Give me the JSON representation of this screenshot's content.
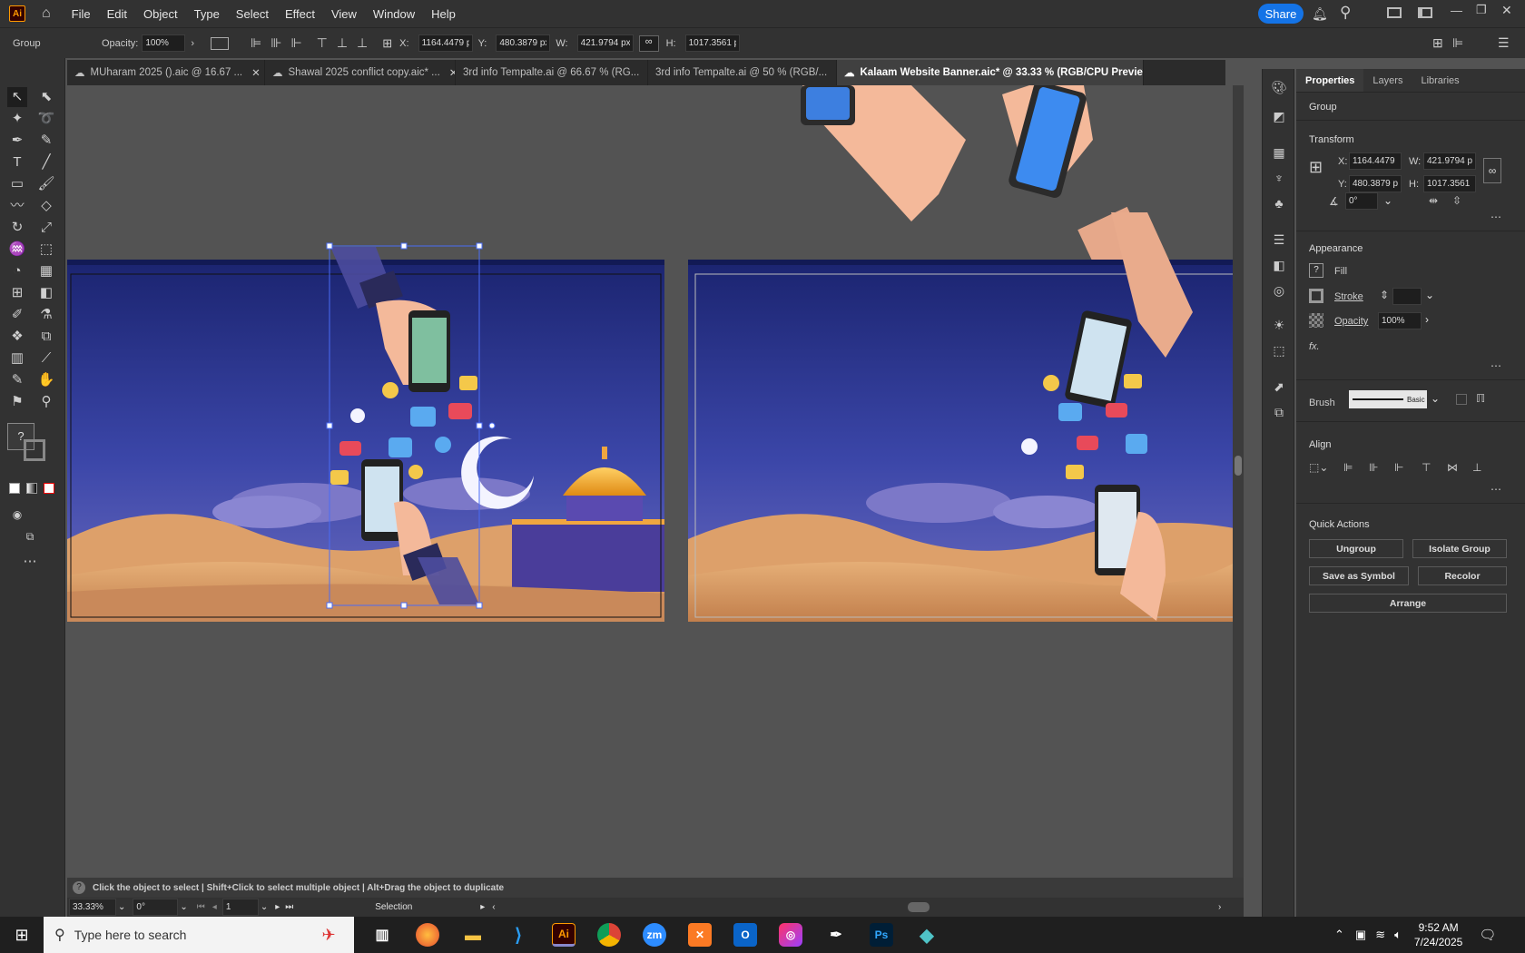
{
  "menubar": {
    "app_icon": "Ai",
    "items": [
      "File",
      "Edit",
      "Object",
      "Type",
      "Select",
      "Effect",
      "View",
      "Window",
      "Help"
    ],
    "share_label": "Share",
    "icons": [
      "home-icon",
      "bell-icon",
      "search-icon",
      "arrange-icon",
      "panel-icon",
      "minimize-icon",
      "restore-icon",
      "close-icon"
    ]
  },
  "control": {
    "selection_label": "Group",
    "opacity_label": "Opacity:",
    "opacity_value": "100%",
    "x_label": "X:",
    "x_value": "1164.4479 px",
    "y_label": "Y:",
    "y_value": "480.3879 px",
    "w_label": "W:",
    "w_value": "421.9794 px",
    "h_label": "H:",
    "h_value": "1017.3561 p"
  },
  "tabs": [
    {
      "label": "MUharam 2025 ().aic @ 16.67 ...",
      "active": false
    },
    {
      "label": "Shawal 2025 conflict copy.aic* ...",
      "active": false
    },
    {
      "label": "3rd info Tempalte.ai @ 66.67 % (RG...",
      "active": false
    },
    {
      "label": "3rd info Tempalte.ai @ 50 % (RGB/...",
      "active": false
    },
    {
      "label": "Kalaam Website Banner.aic* @ 33.33 % (RGB/CPU Preview)",
      "active": true
    }
  ],
  "status": {
    "hint": "Click the object to select  |  Shift+Click to select multiple object  |  Alt+Drag the object to duplicate",
    "zoom": "33.33%",
    "rotation": "0°",
    "artboard": "1",
    "tool": "Selection"
  },
  "properties": {
    "tabs": [
      "Properties",
      "Layers",
      "Libraries"
    ],
    "selection": "Group",
    "transform_title": "Transform",
    "x_label": "X:",
    "x": "1164.4479",
    "y_label": "Y:",
    "y": "480.3879 p",
    "w_label": "W:",
    "w": "421.9794 p",
    "h_label": "H:",
    "h": "1017.3561",
    "angle": "0°",
    "appearance_title": "Appearance",
    "fill_label": "Fill",
    "stroke_label": "Stroke",
    "opacity_label": "Opacity",
    "opacity_value": "100%",
    "fx_label": "fx.",
    "brush_label": "Brush",
    "brush_value": "Basic",
    "align_title": "Align",
    "quick_actions_title": "Quick Actions",
    "btn_ungroup": "Ungroup",
    "btn_isolate": "Isolate Group",
    "btn_symbol": "Save as Symbol",
    "btn_recolor": "Recolor",
    "btn_arrange": "Arrange"
  },
  "taskbar": {
    "search_placeholder": "Type here to search",
    "apps": [
      "task-view",
      "firefox",
      "file-explorer",
      "vscode",
      "illustrator",
      "chrome",
      "zoom",
      "xampp",
      "outlook",
      "creative-cloud",
      "pen-tool",
      "photoshop",
      "app-diamond"
    ],
    "ai_label": "Ai",
    "zoom_label": "zm",
    "ps_label": "Ps",
    "time": "9:52 AM",
    "date": "7/24/2025"
  }
}
